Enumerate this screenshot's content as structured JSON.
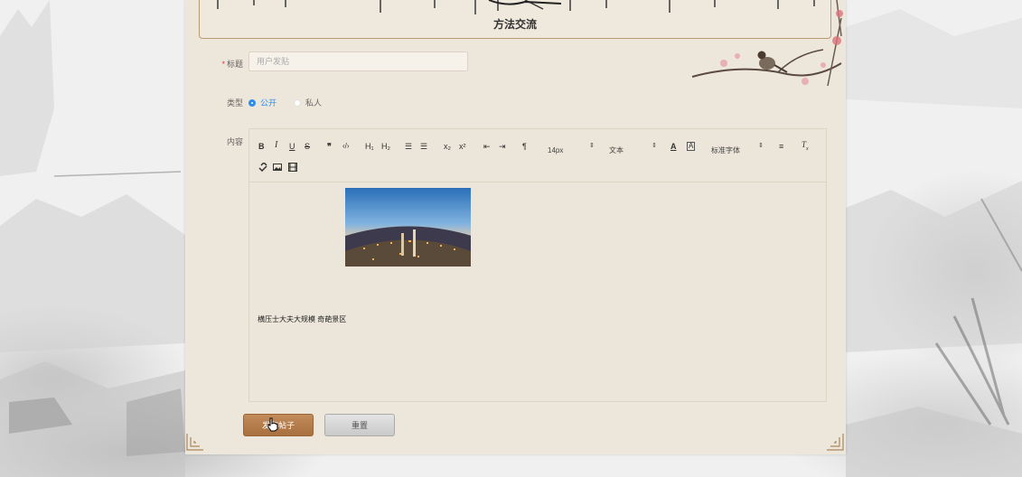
{
  "header": {
    "title": "方法交流"
  },
  "form": {
    "title_label": "标题",
    "title_required_mark": "*",
    "title_placeholder": "用户发贴",
    "type_label": "类型",
    "type_options": [
      {
        "label": "公开",
        "selected": true
      },
      {
        "label": "私人",
        "selected": false
      }
    ],
    "content_label": "内容"
  },
  "toolbar": {
    "bold": "B",
    "italic": "I",
    "underline": "U",
    "strike": "S",
    "blockquote": "❞",
    "code": "‹/›",
    "h1": "H₁",
    "h2": "H₂",
    "ordered_list": "☰",
    "bullet_list": "☰",
    "subscript": "x₂",
    "superscript": "x²",
    "outdent": "⇤",
    "indent": "⇥",
    "direction": "¶",
    "font_size": "14px",
    "block_type": "文本",
    "font_family": "标准字体"
  },
  "editor": {
    "content_text": "横压士大夫大规模 奇葩景区"
  },
  "buttons": {
    "submit": "发布帖子",
    "reset": "重置"
  },
  "colors": {
    "accent": "#2d8cf0",
    "submit_bg": "#b07945",
    "panel_bg": "#ede6da"
  }
}
